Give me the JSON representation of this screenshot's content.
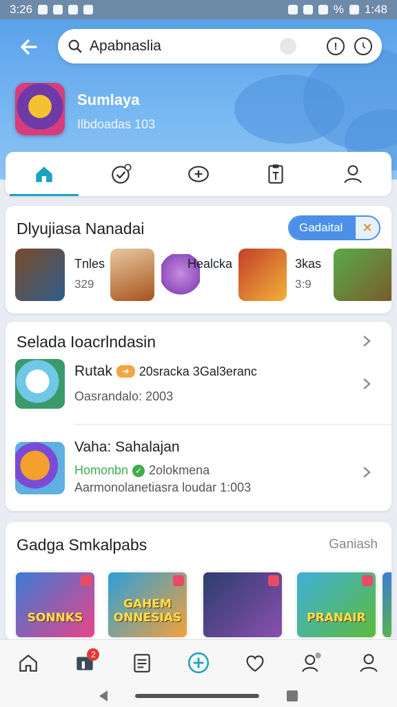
{
  "status_bar": {
    "time_left": "3:26",
    "time_right": "1:48",
    "battery": "%"
  },
  "header": {
    "search_text": "Apabnaslia",
    "app_name": "Sumlaya",
    "app_subtitle": "Ilbdoadas 103"
  },
  "tabs": [
    {
      "icon": "home-icon",
      "active": true
    },
    {
      "icon": "check-badge-icon"
    },
    {
      "icon": "add-circle-icon"
    },
    {
      "icon": "clipboard-icon"
    },
    {
      "icon": "profile-icon"
    }
  ],
  "featured": {
    "title": "Dlyujiasa Nanadai",
    "button_label": "Gadaital",
    "button_icon": "close-x-icon",
    "items": [
      {
        "label": "Tnles",
        "num": "329"
      },
      {
        "label": "Healcka",
        "num": ""
      },
      {
        "label": "3kas",
        "num": "3:9"
      }
    ]
  },
  "recommended": {
    "title": "Selada Ioacrlndasin",
    "rows": [
      {
        "name": "Rutak",
        "extra": "20sracka 3Gal3eranc",
        "meta": "Oasrandalo: 2003"
      },
      {
        "name": "Vaha: Sahalajan",
        "status": "Homonbn",
        "extra": "2olokmena",
        "meta": "Aarmonolanetiasra loudar 1:003"
      }
    ]
  },
  "games": {
    "title": "Gadga Smkalpabs",
    "action": "Ganiash",
    "tiles": [
      {
        "label": "SONNKS",
        "colors": [
          "#3a7bd5",
          "#e8448a"
        ]
      },
      {
        "label": "GAHEM ONNESIAS",
        "colors": [
          "#2d9fd9",
          "#f2a13a"
        ]
      },
      {
        "label": "",
        "colors": [
          "#2c3e6b",
          "#8a4fb0"
        ]
      },
      {
        "label": "PRANAIR",
        "colors": [
          "#3fb0d8",
          "#5dbb3c"
        ]
      }
    ]
  },
  "bottom_nav": {
    "badge_count": "2",
    "items": [
      "home-icon",
      "dashboard-icon",
      "document-icon",
      "add-circle-icon",
      "heart-chat-icon",
      "contacts-icon",
      "profile-icon"
    ]
  }
}
